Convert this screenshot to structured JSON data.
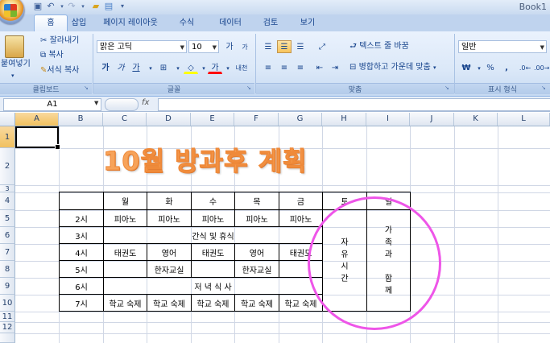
{
  "app": {
    "book_title": "Book1"
  },
  "qat": {
    "save_icon": "save-icon",
    "undo_icon": "undo-icon",
    "redo_icon": "redo-icon",
    "open_icon": "open-icon",
    "more_icon": "dropdown-icon"
  },
  "tabs": [
    "홈",
    "삽입",
    "페이지 레이아웃",
    "수식",
    "데이터",
    "검토",
    "보기"
  ],
  "ribbon": {
    "clipboard": {
      "paste": "붙여넣기",
      "cut": "잘라내기",
      "copy": "복사",
      "format_painter": "서식 복사",
      "label": "클립보드"
    },
    "font": {
      "name": "맑은 고딕",
      "size": "10",
      "grow": "가",
      "shrink": "가",
      "bold": "가",
      "italic": "가",
      "underline": "가",
      "color_a": "가",
      "phonetic": "내천",
      "label": "글꼴"
    },
    "align": {
      "wrap": "텍스트 줄 바꿈",
      "merge": "병합하고 가운데 맞춤",
      "label": "맞춤"
    },
    "number": {
      "format": "일반",
      "currency": "₩",
      "percent": "%",
      "comma": ",",
      "label": "표시 형식"
    }
  },
  "formula_bar": {
    "name_box": "A1",
    "fx": "fx"
  },
  "grid": {
    "columns": [
      "A",
      "B",
      "C",
      "D",
      "E",
      "F",
      "G",
      "H",
      "I",
      "J",
      "K",
      "L"
    ],
    "rows": [
      "1",
      "2",
      "3",
      "4",
      "5",
      "6",
      "7",
      "8",
      "9",
      "10",
      "11",
      "12"
    ]
  },
  "sheet_title": "10월 방과후 계획",
  "schedule": {
    "days": [
      "월",
      "화",
      "수",
      "목",
      "금",
      "토",
      "일"
    ],
    "rows": [
      {
        "period": "2시",
        "cells": [
          "피아노",
          "피아노",
          "피아노",
          "피아노",
          "피아노"
        ]
      },
      {
        "period": "3시",
        "merged": "간식 및 휴식"
      },
      {
        "period": "4시",
        "cells": [
          "태권도",
          "영어",
          "태권도",
          "영어",
          "태권도"
        ]
      },
      {
        "period": "5시",
        "cells": [
          "",
          "한자교실",
          "",
          "한자교실",
          ""
        ]
      },
      {
        "period": "6시",
        "merged": "저 녁 식 사"
      },
      {
        "period": "7시",
        "cells": [
          "학교 숙제",
          "학교 숙제",
          "학교 숙제",
          "학교 숙제",
          "학교 숙제"
        ]
      }
    ],
    "saturday": [
      "자",
      "유",
      "시",
      "간"
    ],
    "sunday": [
      "가",
      "족",
      "과",
      "",
      "함",
      "께"
    ]
  }
}
